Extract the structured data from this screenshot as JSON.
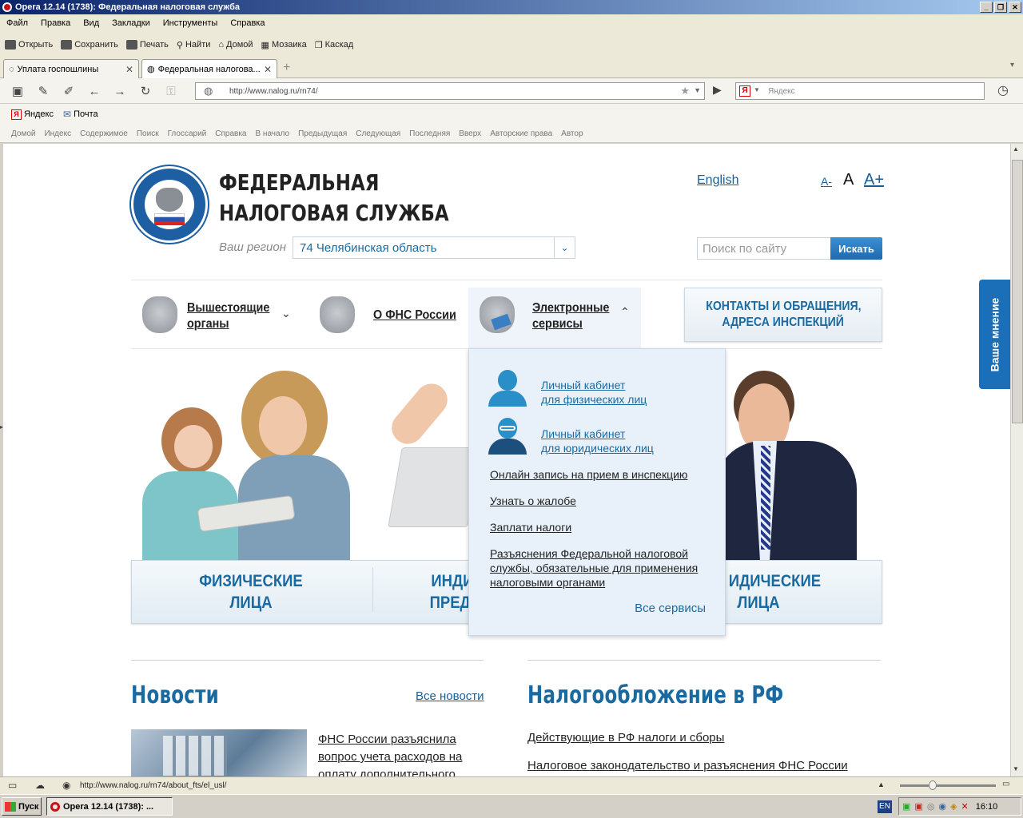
{
  "window": {
    "title": "Opera 12.14 (1738): Федеральная налоговая служба"
  },
  "menu": [
    "Файл",
    "Правка",
    "Вид",
    "Закладки",
    "Инструменты",
    "Справка"
  ],
  "toolbar": [
    "Открыть",
    "Сохранить",
    "Печать",
    "Найти",
    "Домой",
    "Мозаика",
    "Каскад"
  ],
  "tabs": [
    {
      "label": "Уплата госпошлины"
    },
    {
      "label": "Федеральная налогова..."
    }
  ],
  "address": {
    "url": "http://www.nalog.ru/rn74/",
    "search_placeholder": "Яндекс"
  },
  "bookmarks": [
    "Яндекс",
    "Почта"
  ],
  "navlinks": [
    "Домой",
    "Индекс",
    "Содержимое",
    "Поиск",
    "Глоссарий",
    "Справка",
    "В начало",
    "Предыдущая",
    "Следующая",
    "Последняя",
    "Вверх",
    "Авторские права",
    "Автор"
  ],
  "page": {
    "logo_title_1": "ФЕДЕРАЛЬНАЯ",
    "logo_title_2": "НАЛОГОВАЯ СЛУЖБА",
    "region_label": "Ваш регион",
    "region_value": "74 Челябинская область",
    "english": "English",
    "font_small": "A-",
    "font_normal": "A",
    "font_large": "A+",
    "search_placeholder": "Поиск по сайту",
    "search_button": "Искать",
    "nav": {
      "higher_1": "Вышестоящие",
      "higher_2": "органы",
      "about": "О ФНС России",
      "eservices_1": "Электронные",
      "eservices_2": "сервисы",
      "contacts_1": "КОНТАКТЫ И ОБРАЩЕНИЯ,",
      "contacts_2": "АДРЕСА ИНСПЕКЦИЙ"
    },
    "feedback_tab": "Ваше мнение",
    "categories": {
      "individuals_1": "ФИЗИЧЕСКИЕ",
      "individuals_2": "ЛИЦА",
      "entrepreneurs_1": "ИНДИ",
      "entrepreneurs_2": "ПРЕД",
      "legal_1": "ИДИЧЕСКИЕ",
      "legal_2": "ЛИЦА"
    },
    "dropdown": {
      "cab_phys_1": "Личный кабинет",
      "cab_phys_2": "для физических лиц",
      "cab_legal_1": "Личный кабинет",
      "cab_legal_2": "для юридических лиц",
      "appointment": "Онлайн запись на прием в инспекцию",
      "complaint": "Узнать о жалобе",
      "pay": "Заплати налоги",
      "clarify_1": "Разъяснения Федеральной налоговой",
      "clarify_2": "службы, обязательные для применения",
      "clarify_3": "налоговыми органами",
      "all": "Все сервисы"
    },
    "news": {
      "title": "Новости",
      "all": "Все новости",
      "item_1": "ФНС России разъяснила",
      "item_2": "вопрос учета расходов на",
      "item_3": "оплату дополнительного"
    },
    "taxation": {
      "title": "Налогообложение в РФ",
      "link_1": "Действующие в РФ налоги и сборы",
      "link_2": "Налоговое законодательство и разъяснения ФНС России"
    }
  },
  "status": {
    "url": "http://www.nalog.ru/rn74/about_fts/el_usl/"
  },
  "taskbar": {
    "start": "Пуск",
    "task": "Opera 12.14 (1738): ...",
    "lang": "EN",
    "time": "16:10"
  }
}
